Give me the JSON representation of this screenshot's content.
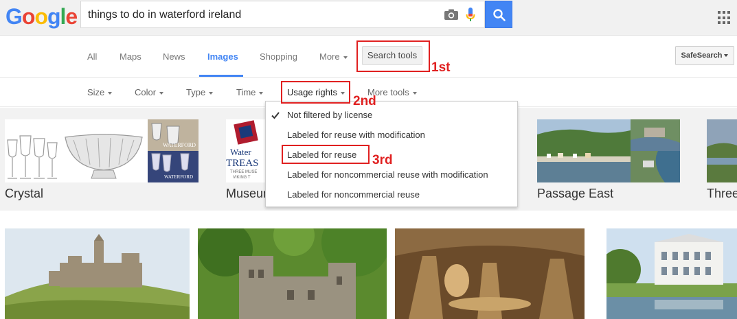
{
  "logo": {
    "g1": "G",
    "o1": "o",
    "o2": "o",
    "g2": "g",
    "l": "l",
    "e": "e"
  },
  "search": {
    "query": "things to do in waterford ireland"
  },
  "icons": {
    "camera": "camera-icon",
    "mic": "mic-icon",
    "search": "magnifier-icon",
    "apps": "apps-grid-icon",
    "check": "checkmark-icon"
  },
  "tabs": [
    {
      "label": "All"
    },
    {
      "label": "Maps"
    },
    {
      "label": "News"
    },
    {
      "label": "Images",
      "active": true
    },
    {
      "label": "Shopping"
    },
    {
      "label": "More"
    }
  ],
  "search_tools": {
    "label": "Search tools"
  },
  "safesearch": {
    "label": "SafeSearch"
  },
  "tools": [
    {
      "label": "Size"
    },
    {
      "label": "Color"
    },
    {
      "label": "Type"
    },
    {
      "label": "Time"
    },
    {
      "label": "Usage rights"
    },
    {
      "label": "More tools"
    }
  ],
  "usage_rights_menu": {
    "items": [
      {
        "label": "Not filtered by license",
        "checked": true
      },
      {
        "label": "Labeled for reuse with modification"
      },
      {
        "label": "Labeled for reuse"
      },
      {
        "label": "Labeled for noncommercial reuse with modification"
      },
      {
        "label": "Labeled for noncommercial reuse"
      }
    ]
  },
  "categories": [
    {
      "label": "Crystal"
    },
    {
      "label": "Museum"
    },
    {
      "label": "Passage East"
    },
    {
      "label": "Three"
    }
  ],
  "thumb_text": {
    "waterford1": "WATERFORD",
    "waterford2": "WATERFORD",
    "treas1": "Water",
    "treas2": "TREAS",
    "treas3": "THREE MUSE",
    "treas4": "VIKING T"
  },
  "annotations": {
    "first": "1st",
    "second": "2nd",
    "third": "3rd"
  },
  "colors": {
    "accent": "#4285f4",
    "annotation": "#e02020"
  }
}
